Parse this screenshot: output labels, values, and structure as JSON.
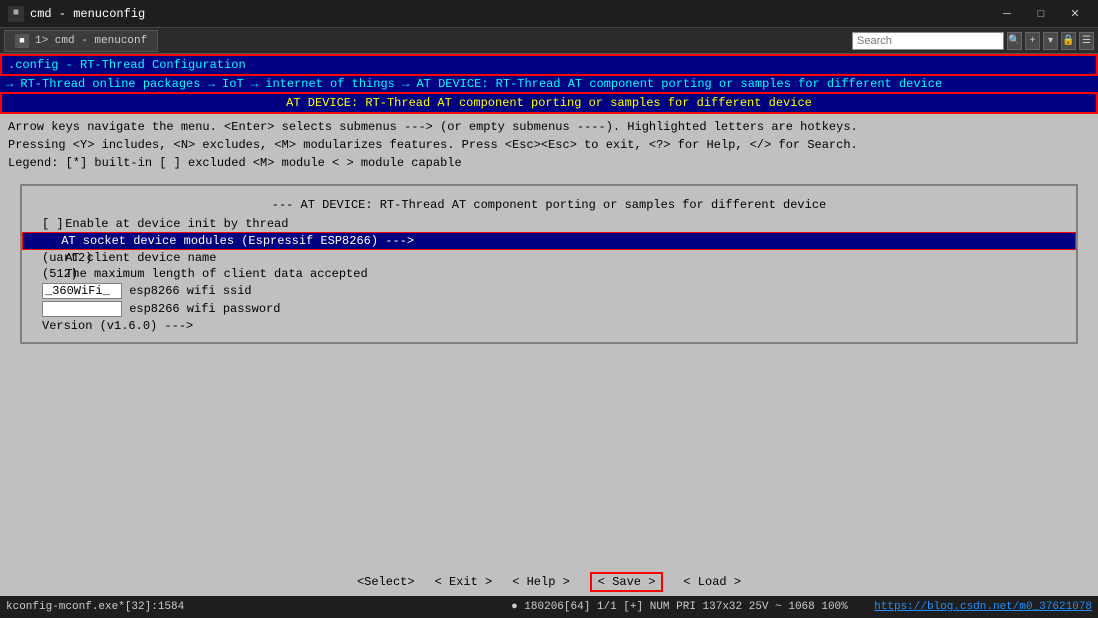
{
  "window": {
    "title": "cmd - menuconfig",
    "tab_label": "1> cmd - menuconf"
  },
  "search": {
    "placeholder": "Search",
    "label": "Search"
  },
  "menuconfig": {
    "config_line": ".config - RT-Thread Configuration",
    "breadcrumb": "→ RT-Thread online packages → IoT → internet of things → AT DEVICE: RT-Thread AT component porting or samples for different device",
    "subtitle": "AT DEVICE: RT-Thread AT component porting or samples for different device",
    "help_line1": "Arrow keys navigate the menu.  <Enter> selects submenus --->  (or empty submenus ----).   Highlighted letters are hotkeys.",
    "help_line2": "Pressing <Y> includes, <N> excludes, <M> modularizes features.  Press <Esc><Esc> to exit, <?> for Help, </> for Search.",
    "help_line3": "Legend: [*] built-in  [ ] excluded  <M> module  < > module capable",
    "menu_title": "--- AT DEVICE: RT-Thread AT component porting or samples for different device",
    "items": [
      {
        "prefix": "[ ]",
        "label": "Enable at device init by thread",
        "suffix": ""
      },
      {
        "prefix": "",
        "label": "AT socket device modules (Espressif ESP8266)",
        "suffix": "--->",
        "selected": true
      },
      {
        "prefix": "(uart2)",
        "label": "AT client device name",
        "suffix": ""
      },
      {
        "prefix": "(512)",
        "label": "The maximum length of client data accepted",
        "suffix": ""
      },
      {
        "prefix": "(_360WiFi_)",
        "label": "esp8266 wifi ssid",
        "suffix": ""
      },
      {
        "prefix": "(        )",
        "label": "esp8266 wifi password",
        "suffix": ""
      },
      {
        "prefix": "",
        "label": "Version (v1.6.0)  --->",
        "suffix": ""
      }
    ],
    "buttons": {
      "select": "<Select>",
      "exit": "< Exit >",
      "help": "< Help >",
      "save": "< Save >",
      "load": "< Load >"
    }
  },
  "status_bar": {
    "left": "kconfig-mconf.exe*[32]:1584",
    "right_info": "● 180206[64]  1/1  [+] NUM  PRI  137x32  25V ~ 1068  100%",
    "right_url": "https://blog.csdn.net/m0_37621078"
  },
  "icons": {
    "window_icon": "■",
    "search_icon": "🔍",
    "minimize": "─",
    "maximize": "□",
    "close": "✕"
  }
}
